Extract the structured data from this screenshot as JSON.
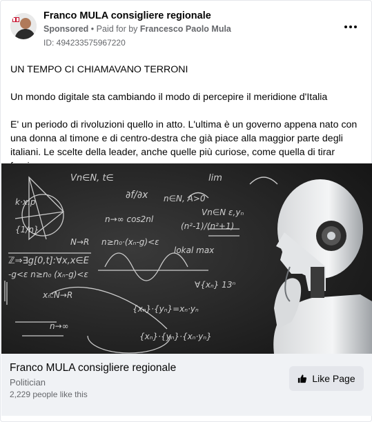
{
  "post": {
    "page_name": "Franco MULA consigliere regionale",
    "sponsored": "Sponsored",
    "separator": "•",
    "paid_prefix": "Paid for by",
    "paid_by": "Francesco Paolo Mula",
    "ad_id": "ID: 494233575967220",
    "body": [
      "UN TEMPO CI CHIAMAVANO TERRONI",
      "Un mondo digitale sta cambiando il modo di percepire il meridione d'Italia",
      "E' un periodo di rivoluzioni quello in atto. L'ultima è un governo appena nato con una donna al timone e di centro-destra che già piace alla maggior parte degli italiani. Le scelte della leader, anche quelle più curiose, come quella di tirar fuori…"
    ]
  },
  "footer": {
    "title": "Franco MULA consigliere regionale",
    "category": "Politician",
    "likes": "2,229 people like this",
    "like_label": "Like Page"
  },
  "icons": {
    "more": "more-horizontal-icon",
    "like": "thumbs-up-icon"
  },
  "colors": {
    "secondary_text": "#65676b",
    "footer_bg": "#f0f2f5",
    "button_bg": "#e4e6eb"
  }
}
